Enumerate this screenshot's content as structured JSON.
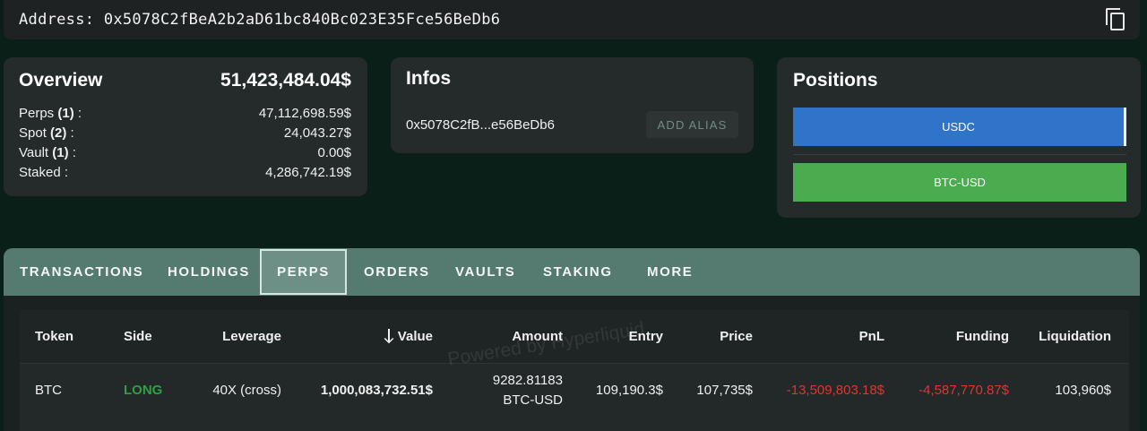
{
  "header": {
    "address_label": "Address: 0x5078C2fBeA2b2aD61bc840Bc023E35Fce56BeDb6",
    "copy_icon": "copy-icon"
  },
  "overview": {
    "title": "Overview",
    "total": "51,423,484.04$",
    "rows": [
      {
        "name": "Perps",
        "count": "(1)",
        "suffix": " :",
        "value": "47,112,698.59$"
      },
      {
        "name": "Spot",
        "count": "(2)",
        "suffix": " :",
        "value": "24,043.27$"
      },
      {
        "name": "Vault",
        "count": "(1)",
        "suffix": " :",
        "value": "0.00$"
      },
      {
        "name": "Staked",
        "count": "",
        "suffix": " :",
        "value": "4,286,742.19$"
      }
    ]
  },
  "infos": {
    "title": "Infos",
    "short_address": "0x5078C2fB...e56BeDb6",
    "alias_button": "ADD ALIAS"
  },
  "positions": {
    "title": "Positions",
    "usdc_label": "USDC",
    "btc_label": "BTC-USD",
    "colors": {
      "usdc": "#2f74c9",
      "btc": "#4aac4f"
    }
  },
  "tabs": [
    "TRANSACTIONS",
    "HOLDINGS",
    "PERPS",
    "ORDERS",
    "VAULTS",
    "STAKING",
    "MORE"
  ],
  "active_tab": "PERPS",
  "table": {
    "columns": [
      "Token",
      "Side",
      "Leverage",
      "Value",
      "Amount",
      "Entry",
      "Price",
      "PnL",
      "Funding",
      "Liquidation"
    ],
    "rows": [
      {
        "token": "BTC",
        "side": "LONG",
        "leverage": "40X (cross)",
        "value": "1,000,083,732.51$",
        "amount_line1": "9282.81183",
        "amount_line2": "BTC-USD",
        "entry": "109,190.3$",
        "price": "107,735$",
        "pnl": "-13,509,803.18$",
        "funding": "-4,587,770.87$",
        "liquidation": "103,960$"
      }
    ]
  },
  "watermark": "Powered by Hyperliquid",
  "colors": {
    "long": "#2ea043",
    "negative": "#e0352f",
    "tabbar": "#557a6f"
  }
}
